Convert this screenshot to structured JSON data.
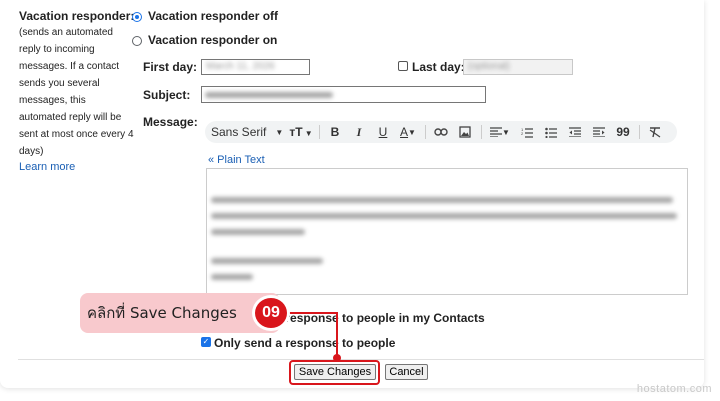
{
  "settings": {
    "label": "Vacation responder:",
    "description_lines": [
      "(sends an automated",
      "reply to incoming",
      "messages. If a contact",
      "sends you several",
      "messages, this",
      "automated reply will be",
      "sent at most once every 4",
      "days)"
    ],
    "learn_more": "Learn more"
  },
  "options": {
    "off_label": "Vacation responder off",
    "on_label": "Vacation responder on",
    "selected": "off"
  },
  "form": {
    "first_day_label": "First day:",
    "first_day_value": "March 11, 2026",
    "last_day_label": "Last day:",
    "last_day_placeholder": "(optional)",
    "last_day_checked": false,
    "subject_label": "Subject:",
    "message_label": "Message:"
  },
  "toolbar": {
    "font_name": "Sans Serif"
  },
  "editor": {
    "plain_text_link": "« Plain Text"
  },
  "contacts": {
    "only_contacts_label": "Only send a response to people in my Contacts",
    "only_contacts_checked": false,
    "only_domain_label": "Only send a response to people",
    "only_domain_checked": true
  },
  "buttons": {
    "save": "Save Changes",
    "cancel": "Cancel"
  },
  "annotation": {
    "callout_text": "คลิกที่  Save Changes",
    "step_number": "09",
    "accent_color": "#d9161c",
    "callout_color": "#f8c9cd"
  },
  "watermark": "hostatom.com"
}
